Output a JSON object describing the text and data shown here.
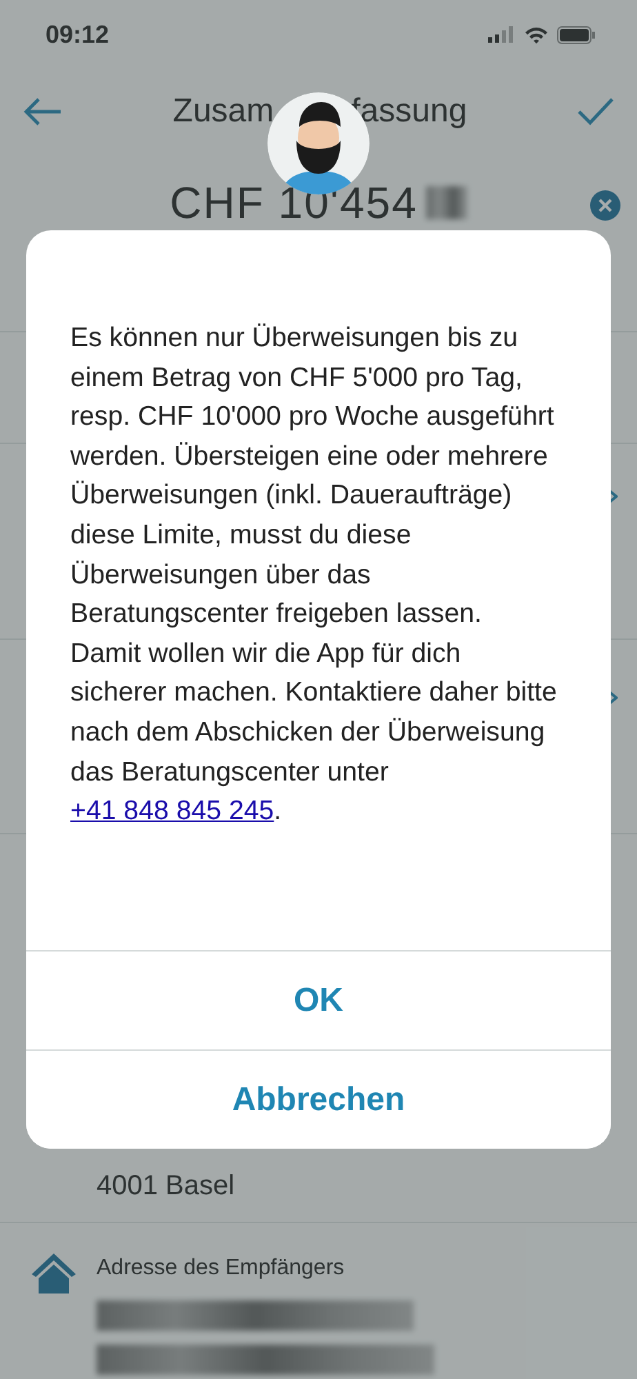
{
  "status_bar": {
    "time": "09:12"
  },
  "nav": {
    "title_left": "Zusam",
    "title_right": "fassung"
  },
  "amount": {
    "text": "CHF 10'454"
  },
  "address": {
    "line": "4001 Basel"
  },
  "recipient": {
    "label": "Adresse des Empfängers"
  },
  "dialog": {
    "message_before": "Es können nur Überweisungen bis zu einem Betrag von CHF 5'000 pro Tag, resp. CHF 10'000 pro Woche ausgeführt werden. Übersteigen eine oder mehrere Überweisungen (inkl. Daueraufträge) diese Limite, musst du diese Überweisungen über das Beratungscenter freigeben lassen. Damit wollen wir die App für dich sicherer machen. Kontaktiere daher bitte nach dem Abschicken der Überweisung das Beratungscenter unter ",
    "phone_link": "+41 848 845 245",
    "message_after": ".",
    "buttons": [
      {
        "label": "OK"
      },
      {
        "label": "Abbrechen"
      }
    ]
  }
}
